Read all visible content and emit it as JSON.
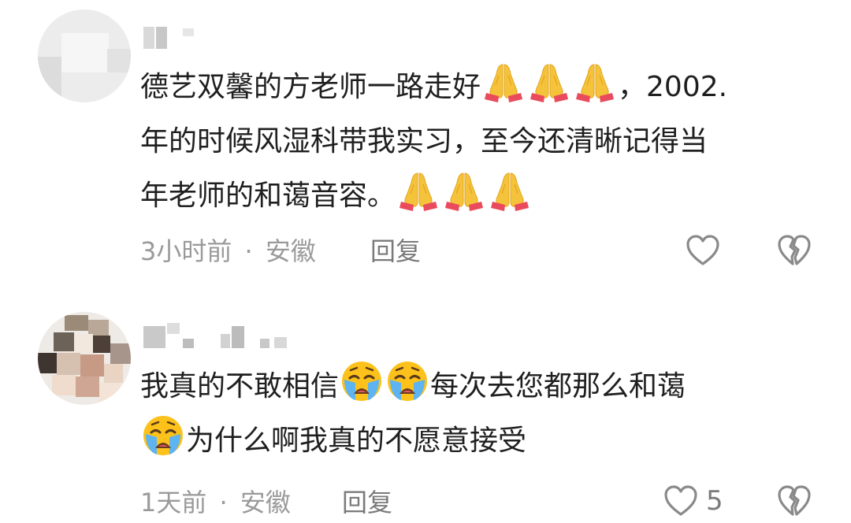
{
  "comments": [
    {
      "username": "",
      "line1": "德艺双馨的方老师一路走好",
      "line1_tail": "，2002.",
      "line2": "年的时候风湿科带我实习，至今还清晰记得当",
      "line3": "年老师的和蔼音容。",
      "time": "3小时前",
      "separator": "·",
      "location": "安徽",
      "reply_label": "回复",
      "like_count": ""
    },
    {
      "username": "",
      "line1_a": "我真的不敢相信",
      "line1_b": "每次去您都那么和蔼",
      "line2": "为什么啊我真的不愿意接受",
      "time": "1天前",
      "separator": "·",
      "location": "安徽",
      "reply_label": "回复",
      "like_count": "5"
    }
  ],
  "icons": {
    "pray": "folded-hands-emoji",
    "cry": "loudly-crying-face-emoji",
    "like": "heart-outline-icon",
    "dislike": "broken-heart-outline-icon"
  },
  "colors": {
    "text": "#1f1f1f",
    "meta": "#9a9a9a",
    "icon": "#8a8a8a"
  }
}
